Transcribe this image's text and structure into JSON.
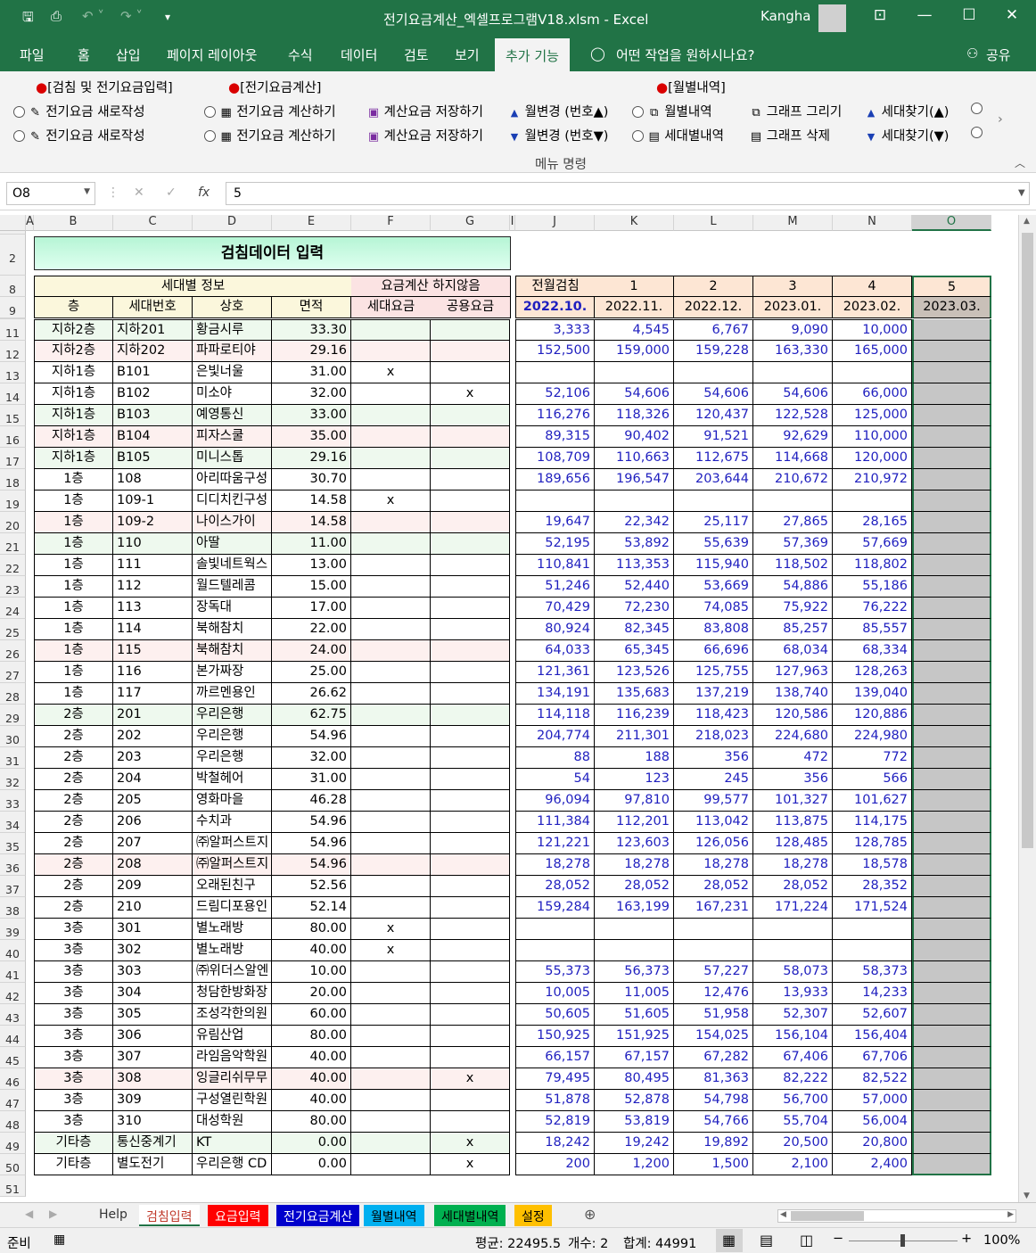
{
  "window": {
    "title": "전기요금계산_엑셀프로그램V18.xlsm  -  Excel",
    "user": "Kangha"
  },
  "menu": [
    "파일",
    "홈",
    "삽입",
    "페이지 레이아웃",
    "수식",
    "데이터",
    "검토",
    "보기",
    "추가 기능"
  ],
  "menu_active": "추가 기능",
  "tell_me": "어떤 작업을 원하시나요?",
  "share": "공유",
  "ribbon": {
    "group1_header": "[검침 및 전기요금입력]",
    "group2_header": "[전기요금계산]",
    "group3_header": "[월별내역]",
    "new_bill": "전기요금 새로작성",
    "calc_bill": "전기요금 계산하기",
    "save_bill": "계산요금 저장하기",
    "month_up": "월변경 (번호▲)",
    "month_down": "월변경 (번호▼)",
    "monthly": "월별내역",
    "per_unit": "세대별내역",
    "draw_graph": "그래프 그리기",
    "del_graph": "그래프 삭제",
    "find_up": "세대찾기(▲)",
    "find_down": "세대찾기(▼)",
    "group_label": "메뉴 명령"
  },
  "formula": {
    "namebox": "O8",
    "value": "5"
  },
  "columns": [
    "A",
    "B",
    "C",
    "D",
    "E",
    "F",
    "G",
    "I",
    "J",
    "K",
    "L",
    "M",
    "N",
    "O"
  ],
  "sheet": {
    "title": "검침데이터 입력",
    "h_info": "세대별 정보",
    "h_exclude": "요금계산 하지않음",
    "h_floor": "층",
    "h_unit": "세대번호",
    "h_name": "상호",
    "h_area": "면적",
    "h_unitfee": "세대요금",
    "h_commonfee": "공용요금",
    "h_prev": "전월검침",
    "month_nums": [
      "1",
      "2",
      "3",
      "4",
      "5"
    ],
    "months": [
      "2022.10.",
      "2022.11.",
      "2022.12.",
      "2023.01.",
      "2023.02.",
      "2023.03."
    ]
  },
  "rows": [
    {
      "n": "11",
      "f": "지하2층",
      "u": "지하201",
      "s": "황금시루",
      "a": "33.30",
      "x1": "",
      "x2": "",
      "v": [
        "3,333",
        "4,545",
        "6,767",
        "9,090",
        "10,000"
      ]
    },
    {
      "n": "12",
      "f": "지하2층",
      "u": "지하202",
      "s": "파파로티야",
      "a": "29.16",
      "x1": "",
      "x2": "",
      "v": [
        "152,500",
        "159,000",
        "159,228",
        "163,330",
        "165,000"
      ]
    },
    {
      "n": "13",
      "f": "지하1층",
      "u": "B101",
      "s": "은빛너울",
      "a": "31.00",
      "x1": "x",
      "x2": "",
      "v": [
        "",
        "",
        "",
        "",
        ""
      ]
    },
    {
      "n": "14",
      "f": "지하1층",
      "u": "B102",
      "s": "미소야",
      "a": "32.00",
      "x1": "",
      "x2": "x",
      "v": [
        "52,106",
        "54,606",
        "54,606",
        "54,606",
        "66,000"
      ]
    },
    {
      "n": "15",
      "f": "지하1층",
      "u": "B103",
      "s": "예영통신",
      "a": "33.00",
      "x1": "",
      "x2": "",
      "v": [
        "116,276",
        "118,326",
        "120,437",
        "122,528",
        "125,000"
      ]
    },
    {
      "n": "16",
      "f": "지하1층",
      "u": "B104",
      "s": "피자스쿨",
      "a": "35.00",
      "x1": "",
      "x2": "",
      "v": [
        "89,315",
        "90,402",
        "91,521",
        "92,629",
        "110,000"
      ]
    },
    {
      "n": "17",
      "f": "지하1층",
      "u": "B105",
      "s": "미니스톱",
      "a": "29.16",
      "x1": "",
      "x2": "",
      "v": [
        "108,709",
        "110,663",
        "112,675",
        "114,668",
        "120,000"
      ]
    },
    {
      "n": "18",
      "f": "1층",
      "u": "108",
      "s": "아리따움구성",
      "a": "30.70",
      "x1": "",
      "x2": "",
      "v": [
        "189,656",
        "196,547",
        "203,644",
        "210,672",
        "210,972"
      ]
    },
    {
      "n": "19",
      "f": "1층",
      "u": "109-1",
      "s": "디디치킨구성",
      "a": "14.58",
      "x1": "x",
      "x2": "",
      "v": [
        "",
        "",
        "",
        "",
        ""
      ]
    },
    {
      "n": "20",
      "f": "1층",
      "u": "109-2",
      "s": "나이스가이",
      "a": "14.58",
      "x1": "",
      "x2": "",
      "v": [
        "19,647",
        "22,342",
        "25,117",
        "27,865",
        "28,165"
      ]
    },
    {
      "n": "21",
      "f": "1층",
      "u": "110",
      "s": "아딸",
      "a": "11.00",
      "x1": "",
      "x2": "",
      "v": [
        "52,195",
        "53,892",
        "55,639",
        "57,369",
        "57,669"
      ]
    },
    {
      "n": "22",
      "f": "1층",
      "u": "111",
      "s": "솔빛네트웍스",
      "a": "13.00",
      "x1": "",
      "x2": "",
      "v": [
        "110,841",
        "113,353",
        "115,940",
        "118,502",
        "118,802"
      ]
    },
    {
      "n": "23",
      "f": "1층",
      "u": "112",
      "s": "월드텔레콤",
      "a": "15.00",
      "x1": "",
      "x2": "",
      "v": [
        "51,246",
        "52,440",
        "53,669",
        "54,886",
        "55,186"
      ]
    },
    {
      "n": "24",
      "f": "1층",
      "u": "113",
      "s": "장독대",
      "a": "17.00",
      "x1": "",
      "x2": "",
      "v": [
        "70,429",
        "72,230",
        "74,085",
        "75,922",
        "76,222"
      ]
    },
    {
      "n": "25",
      "f": "1층",
      "u": "114",
      "s": "북해참치",
      "a": "22.00",
      "x1": "",
      "x2": "",
      "v": [
        "80,924",
        "82,345",
        "83,808",
        "85,257",
        "85,557"
      ]
    },
    {
      "n": "26",
      "f": "1층",
      "u": "115",
      "s": "북해참치",
      "a": "24.00",
      "x1": "",
      "x2": "",
      "v": [
        "64,033",
        "65,345",
        "66,696",
        "68,034",
        "68,334"
      ]
    },
    {
      "n": "27",
      "f": "1층",
      "u": "116",
      "s": "본가짜장",
      "a": "25.00",
      "x1": "",
      "x2": "",
      "v": [
        "121,361",
        "123,526",
        "125,755",
        "127,963",
        "128,263"
      ]
    },
    {
      "n": "28",
      "f": "1층",
      "u": "117",
      "s": "까르멘용인",
      "a": "26.62",
      "x1": "",
      "x2": "",
      "v": [
        "134,191",
        "135,683",
        "137,219",
        "138,740",
        "139,040"
      ]
    },
    {
      "n": "29",
      "f": "2층",
      "u": "201",
      "s": "우리은행",
      "a": "62.75",
      "x1": "",
      "x2": "",
      "v": [
        "114,118",
        "116,239",
        "118,423",
        "120,586",
        "120,886"
      ]
    },
    {
      "n": "30",
      "f": "2층",
      "u": "202",
      "s": "우리은행",
      "a": "54.96",
      "x1": "",
      "x2": "",
      "v": [
        "204,774",
        "211,301",
        "218,023",
        "224,680",
        "224,980"
      ]
    },
    {
      "n": "31",
      "f": "2층",
      "u": "203",
      "s": "우리은행",
      "a": "32.00",
      "x1": "",
      "x2": "",
      "v": [
        "88",
        "188",
        "356",
        "472",
        "772"
      ]
    },
    {
      "n": "32",
      "f": "2층",
      "u": "204",
      "s": "박철헤어",
      "a": "31.00",
      "x1": "",
      "x2": "",
      "v": [
        "54",
        "123",
        "245",
        "356",
        "566"
      ]
    },
    {
      "n": "33",
      "f": "2층",
      "u": "205",
      "s": "영화마을",
      "a": "46.28",
      "x1": "",
      "x2": "",
      "v": [
        "96,094",
        "97,810",
        "99,577",
        "101,327",
        "101,627"
      ]
    },
    {
      "n": "34",
      "f": "2층",
      "u": "206",
      "s": "수치과",
      "a": "54.96",
      "x1": "",
      "x2": "",
      "v": [
        "111,384",
        "112,201",
        "113,042",
        "113,875",
        "114,175"
      ]
    },
    {
      "n": "35",
      "f": "2층",
      "u": "207",
      "s": "㈜알퍼스트지",
      "a": "54.96",
      "x1": "",
      "x2": "",
      "v": [
        "121,221",
        "123,603",
        "126,056",
        "128,485",
        "128,785"
      ]
    },
    {
      "n": "36",
      "f": "2층",
      "u": "208",
      "s": "㈜알퍼스트지",
      "a": "54.96",
      "x1": "",
      "x2": "",
      "v": [
        "18,278",
        "18,278",
        "18,278",
        "18,278",
        "18,578"
      ]
    },
    {
      "n": "37",
      "f": "2층",
      "u": "209",
      "s": "오래된친구",
      "a": "52.56",
      "x1": "",
      "x2": "",
      "v": [
        "28,052",
        "28,052",
        "28,052",
        "28,052",
        "28,352"
      ]
    },
    {
      "n": "38",
      "f": "2층",
      "u": "210",
      "s": "드림디포용인",
      "a": "52.14",
      "x1": "",
      "x2": "",
      "v": [
        "159,284",
        "163,199",
        "167,231",
        "171,224",
        "171,524"
      ]
    },
    {
      "n": "39",
      "f": "3층",
      "u": "301",
      "s": "별노래방",
      "a": "80.00",
      "x1": "x",
      "x2": "",
      "v": [
        "",
        "",
        "",
        "",
        ""
      ]
    },
    {
      "n": "40",
      "f": "3층",
      "u": "302",
      "s": "별노래방",
      "a": "40.00",
      "x1": "x",
      "x2": "",
      "v": [
        "",
        "",
        "",
        "",
        ""
      ]
    },
    {
      "n": "41",
      "f": "3층",
      "u": "303",
      "s": "㈜위더스알엔",
      "a": "10.00",
      "x1": "",
      "x2": "",
      "v": [
        "55,373",
        "56,373",
        "57,227",
        "58,073",
        "58,373"
      ]
    },
    {
      "n": "42",
      "f": "3층",
      "u": "304",
      "s": "청담한방화장",
      "a": "20.00",
      "x1": "",
      "x2": "",
      "v": [
        "10,005",
        "11,005",
        "12,476",
        "13,933",
        "14,233"
      ]
    },
    {
      "n": "43",
      "f": "3층",
      "u": "305",
      "s": "조성각한의원",
      "a": "60.00",
      "x1": "",
      "x2": "",
      "v": [
        "50,605",
        "51,605",
        "51,958",
        "52,307",
        "52,607"
      ]
    },
    {
      "n": "44",
      "f": "3층",
      "u": "306",
      "s": "유림산업",
      "a": "80.00",
      "x1": "",
      "x2": "",
      "v": [
        "150,925",
        "151,925",
        "154,025",
        "156,104",
        "156,404"
      ]
    },
    {
      "n": "45",
      "f": "3층",
      "u": "307",
      "s": "라임음악학원",
      "a": "40.00",
      "x1": "",
      "x2": "",
      "v": [
        "66,157",
        "67,157",
        "67,282",
        "67,406",
        "67,706"
      ]
    },
    {
      "n": "46",
      "f": "3층",
      "u": "308",
      "s": "잉글리쉬무무",
      "a": "40.00",
      "x1": "",
      "x2": "x",
      "v": [
        "79,495",
        "80,495",
        "81,363",
        "82,222",
        "82,522"
      ]
    },
    {
      "n": "47",
      "f": "3층",
      "u": "309",
      "s": "구성열린학원",
      "a": "40.00",
      "x1": "",
      "x2": "",
      "v": [
        "51,878",
        "52,878",
        "54,798",
        "56,700",
        "57,000"
      ]
    },
    {
      "n": "48",
      "f": "3층",
      "u": "310",
      "s": "대성학원",
      "a": "80.00",
      "x1": "",
      "x2": "",
      "v": [
        "52,819",
        "53,819",
        "54,766",
        "55,704",
        "56,004"
      ]
    },
    {
      "n": "49",
      "f": "기타층",
      "u": "통신중계기",
      "s": "KT",
      "a": "0.00",
      "x1": "",
      "x2": "x",
      "v": [
        "18,242",
        "19,242",
        "19,892",
        "20,500",
        "20,800"
      ]
    },
    {
      "n": "50",
      "f": "기타층",
      "u": "별도전기",
      "s": "우리은행 CD",
      "a": "0.00",
      "x1": "",
      "x2": "x",
      "v": [
        "200",
        "1,200",
        "1,500",
        "2,100",
        "2,400"
      ]
    }
  ],
  "sheet_tabs": [
    {
      "label": "Help",
      "color": "#f0f0f0",
      "fg": "#333"
    },
    {
      "label": "검침입력",
      "color": "#ffffff",
      "fg": "#c0392b"
    },
    {
      "label": "요금입력",
      "color": "#ff0000",
      "fg": "#ffffff"
    },
    {
      "label": "전기요금계산",
      "color": "#0000cc",
      "fg": "#ffffff"
    },
    {
      "label": "월별내역",
      "color": "#00b0f0",
      "fg": "#000000"
    },
    {
      "label": "세대별내역",
      "color": "#00b050",
      "fg": "#000000"
    },
    {
      "label": "설정",
      "color": "#ffc000",
      "fg": "#000000"
    }
  ],
  "status": {
    "ready": "준비",
    "avg": "평균: 22495.5",
    "count": "개수: 2",
    "sum": "합계: 44991",
    "zoom": "100%"
  }
}
